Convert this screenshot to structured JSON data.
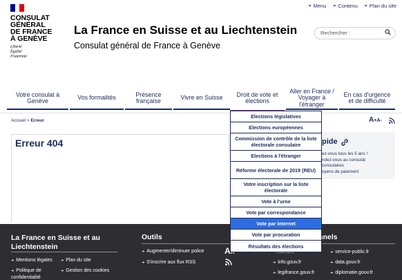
{
  "top_links": [
    "Menu",
    "Contenu",
    "Plan du site"
  ],
  "logo": {
    "lines": [
      "CONSULAT",
      "GÉNÉRAL",
      "DE FRANCE",
      "À GENÈVE"
    ],
    "motto": [
      "Liberté",
      "Égalité",
      "Fraternité"
    ],
    "flag_colors": [
      "#000091",
      "#ffffff",
      "#e1000f"
    ]
  },
  "site": {
    "title": "La France en Suisse et au Liechtenstein",
    "subtitle": "Consulat général de France à Genève"
  },
  "search": {
    "placeholder": "Rechercher :"
  },
  "nav": {
    "items": [
      {
        "label": "Votre consulat à Genève"
      },
      {
        "label": "Vos formalités"
      },
      {
        "label": "Présence française"
      },
      {
        "label": "Vivre en Suisse"
      },
      {
        "label": "Droit de vote et élections"
      },
      {
        "label": "Aller en France / Voyager à l'étranger"
      },
      {
        "label": "En cas d'urgence et de difficulté"
      }
    ],
    "active_index": 4
  },
  "breadcrumb": {
    "home": "Accueil",
    "separator": ">",
    "current": "Erreur"
  },
  "tools": {
    "font_big": "A",
    "font_small": "A",
    "plus": "+",
    "minus": "-"
  },
  "error": {
    "title": "Erreur 404"
  },
  "side_card": {
    "title": "pide",
    "lines": [
      "ez-vous tous les 5 ans !",
      "ndez-vous au consulat",
      "consulaires",
      "oyens de paiement"
    ]
  },
  "dropdown": {
    "items": [
      "Elections législatives",
      "Elections européennes",
      "Commission de contrôle de la liste électorale consulaire",
      "Elections à l'étranger",
      "Réforme électorale de 2019 (REU)",
      "Votre inscription sur la liste électorale",
      "Vote à l'urne",
      "Vote par correspondance",
      "Vote par internet",
      "Vote par procuration",
      "Résultats des élections"
    ],
    "hover_index": 8
  },
  "footer": {
    "col1": {
      "title": "La France en Suisse et au Liechtenstein",
      "links": [
        "Mentions légales",
        "Plan du site",
        "Politique de confidentialité",
        "Gestion des cookies"
      ]
    },
    "col2": {
      "title": "Outils",
      "links": [
        "Augmenter/diminuer police",
        "S'inscrire aux flux RSS"
      ],
      "font_icon": "A",
      "font_icon_small": "A"
    },
    "col3": {
      "title": "nationnels",
      "links": [
        "service-public.fr",
        "info.gouv.fr",
        "data.gouv.fr",
        "legifrance.gouv.fr",
        "diplomatie.gouv.fr"
      ],
      "partial": "rnement"
    }
  },
  "colors": {
    "navy": "#1a2b5c",
    "accent_purple": "#8d3b8a",
    "hover_blue": "#2d6be0",
    "footer_bg": "#2e2e32"
  }
}
